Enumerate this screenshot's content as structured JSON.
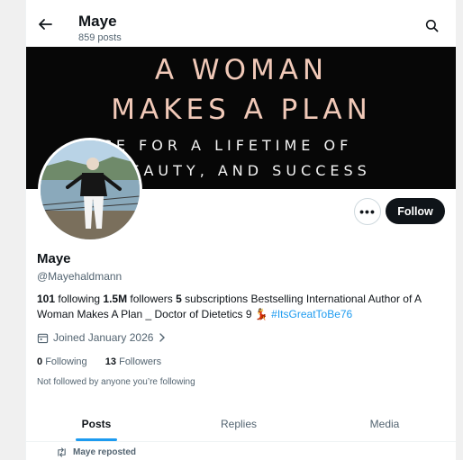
{
  "header": {
    "title": "Maye",
    "posts_count": "859 posts"
  },
  "banner": {
    "line1": "A WOMAN",
    "line2": "MAKES A PLAN",
    "line3": "VICE FOR A LIFETIME OF",
    "line4": "RE, BEAUTY, AND SUCCESS"
  },
  "actions": {
    "more_label": "•••",
    "follow_label": "Follow"
  },
  "profile": {
    "name": "Maye",
    "handle": "@Mayehaldmann",
    "bio": {
      "following_count": "101",
      "following_label": " following ",
      "followers_count": "1.5M",
      "followers_label": " followers ",
      "subscriptions_count": "5",
      "subscriptions_label": " subscriptions ",
      "text": "Bestselling International Author of A Woman Makes A Plan _ Doctor of Dietetics 9 💃 ",
      "hashtag": "#ItsGreatToBe76"
    },
    "joined": "Joined January 2026",
    "following_count": "0",
    "following_label": "Following",
    "followers_count": "13",
    "followers_label": "Followers",
    "not_followed": "Not followed by anyone you’re following"
  },
  "tabs": [
    {
      "label": "Posts",
      "active": true
    },
    {
      "label": "Replies",
      "active": false
    },
    {
      "label": "Media",
      "active": false
    }
  ],
  "feed": {
    "repost_label": "Maye reposted"
  },
  "colors": {
    "accent": "#1d9bf0",
    "text": "#0f1419",
    "muted": "#536471"
  }
}
